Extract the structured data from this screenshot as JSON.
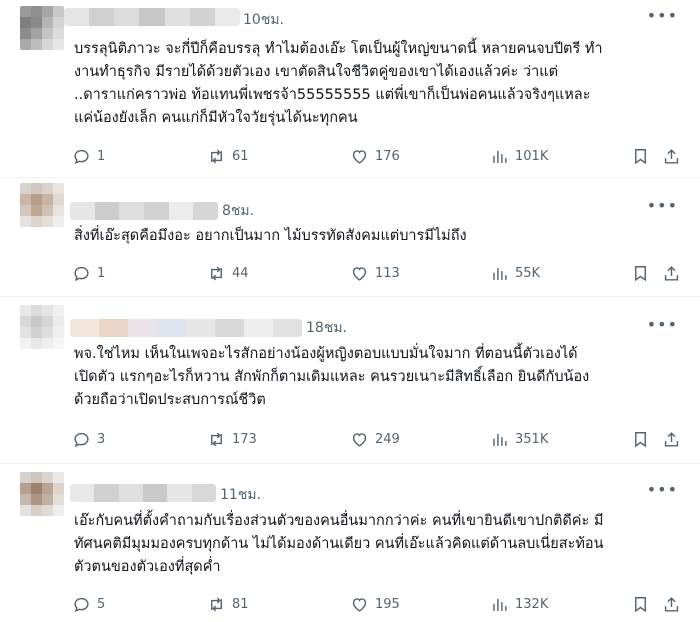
{
  "posts": [
    {
      "time": "10ชม.",
      "text": "บรรลุนิติภาวะ จะกี่ปีก็คือบรรลุ ทำไมต้องเอ๊ะ โตเป็นผู้ใหญ่ขนาดนี้ หลายคนจบปีตรี ทำ\nงานทำธุรกิจ มีรายได้ด้วยตัวเอง เขาตัดสินใจชีวิตคู่ของเขาได้เองแล้วค่ะ ว่าแต่\n..ดาราแก่คราวพ่อ ท้อแทนพี่เพชรจ้า55555555 แต่พี่เขาก็เป็นพ่อคนแล้วจริงๆแหละ\nแค่น้องยังเล็ก คนแก่ก็มีหัวใจวัยรุ่นได้นะทุกคน",
      "replies": "1",
      "reposts": "61",
      "likes": "176",
      "views": "101K"
    },
    {
      "time": "8ชม.",
      "text": "สิ่งที่เอ๊ะสุดคือมึงอะ อยากเป็นมาก ไม้บรรทัดสังคมแต่บารมีไม่ถึง",
      "replies": "1",
      "reposts": "44",
      "likes": "113",
      "views": "55K"
    },
    {
      "time": "18ชม.",
      "text": "พจ.ใช่ไหม เห็นในเพจอะไรสักอย่างน้องผู้หญิงตอบแบบมั่นใจมาก ที่ตอนนี้ตัวเองได้\nเปิดตัว แรกๆอะไรก็หวาน สักพักก็ตามเดิมแหละ คนรวยเนาะมีสิทธิ์เลือก ยินดีกับน้อง\nด้วยถือว่าเปิดประสบการณ์ชีวิต",
      "replies": "3",
      "reposts": "173",
      "likes": "249",
      "views": "351K"
    },
    {
      "time": "11ชม.",
      "text": "เอ๊ะกับคนที่ตั้งคำถามกับเรื่องส่วนตัวของคนอื่นมากกว่าค่ะ คนที่เขายินดีเขาปกติดีค่ะ มี\nทัศนคติมีมุมมองครบทุกด้าน ไม่ได้มองด้านเดียว คนที่เอ๊ะแล้วคิดแต่ด้านลบเนี่ยสะท้อน\nตัวตนของตัวเองที่สุดค่ำ",
      "replies": "5",
      "reposts": "81",
      "likes": "195",
      "views": "132K"
    }
  ],
  "icons": {
    "reply": "reply-icon",
    "repost": "repost-icon",
    "like": "heart-icon",
    "views": "analytics-icon",
    "bookmark": "bookmark-icon",
    "share": "share-icon",
    "more": "more-icon"
  },
  "colors": {
    "text": "#0f1419",
    "muted": "#536471",
    "divider": "#eff3f4"
  }
}
